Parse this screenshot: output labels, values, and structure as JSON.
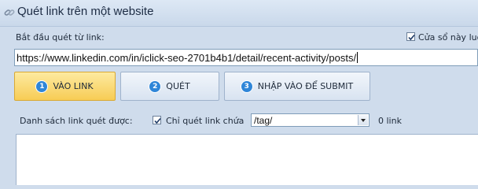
{
  "window": {
    "title": "Quét link trên một website"
  },
  "start_link": {
    "label": "Bắt đầu quét từ link:",
    "value": "https://www.linkedin.com/in/iclick-seo-2701b4b1/detail/recent-activity/posts/"
  },
  "window_option": {
    "label": "Cửa sổ này luô",
    "checked": true
  },
  "steps": [
    {
      "number": "1",
      "label": "VÀO LINK",
      "active": true
    },
    {
      "number": "2",
      "label": "QUÉT",
      "active": false
    },
    {
      "number": "3",
      "label": "NHẬP VÀO ĐỂ SUBMIT",
      "active": false
    }
  ],
  "scan_list": {
    "label": "Danh sách link quét được:",
    "filter_checkbox_label": "Chỉ quét link chứa",
    "filter_checked": true,
    "filter_value": "/tag/",
    "count": "0 link"
  },
  "colors": {
    "active_step": "#f7cc55",
    "step_number": "#2f86d8",
    "background": "#cfdcec"
  }
}
